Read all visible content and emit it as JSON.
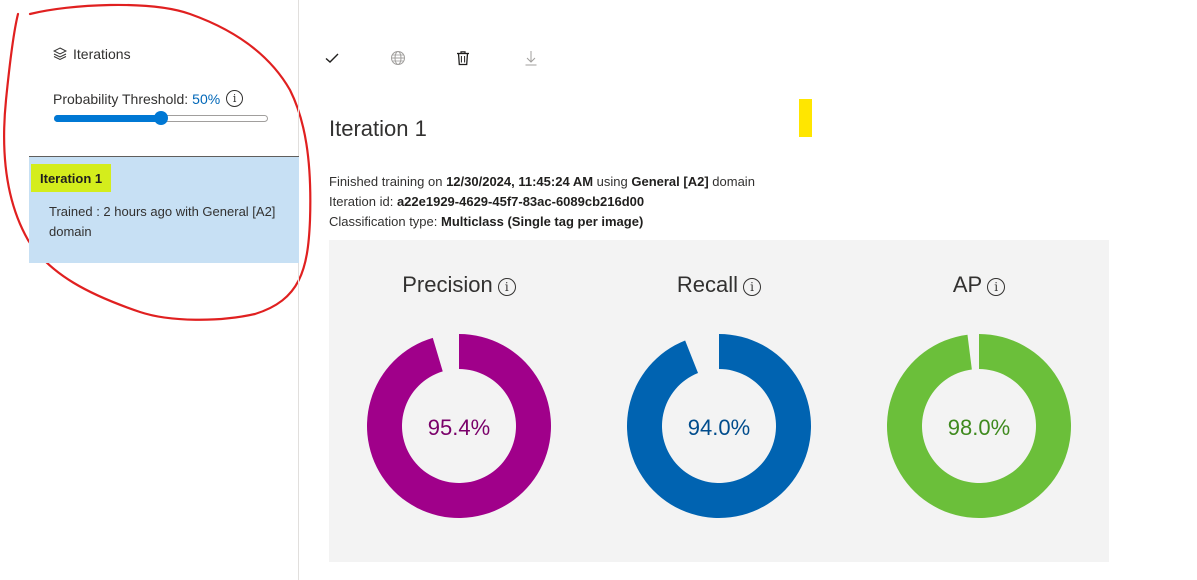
{
  "sidebar": {
    "header_label": "Iterations",
    "threshold_label": "Probability Threshold:",
    "threshold_value": "50%",
    "threshold_fraction": 0.5,
    "iterations": [
      {
        "name": "Iteration 1",
        "description": "Trained : 2 hours ago with General [A2] domain"
      }
    ]
  },
  "toolbar": {
    "icons": [
      "check-icon",
      "globe-icon",
      "trash-icon",
      "download-icon"
    ]
  },
  "main": {
    "title": "Iteration 1",
    "finished_prefix": "Finished training on ",
    "finished_date": "12/30/2024, 11:45:24 AM",
    "finished_mid": " using ",
    "finished_domain": "General [A2]",
    "finished_suffix": " domain",
    "iteration_id_label": "Iteration id: ",
    "iteration_id": "a22e1929-4629-45f7-83ac-6089cb216d00",
    "classification_label": "Classification type: ",
    "classification_value": "Multiclass (Single tag per image)"
  },
  "metrics": [
    {
      "name": "Precision",
      "value": 95.4,
      "display": "95.4%",
      "color": "#a0008a",
      "text_color": "#7a006a"
    },
    {
      "name": "Recall",
      "value": 94.0,
      "display": "94.0%",
      "color": "#0063b1",
      "text_color": "#004c8c"
    },
    {
      "name": "AP",
      "value": 98.0,
      "display": "98.0%",
      "color": "#6bbf3a",
      "text_color": "#3f8a1e"
    }
  ],
  "annotations": {
    "red_circle_color": "#e02020",
    "yellow_mark_color": "#ffe600",
    "highlight_color": "#d4ed1c"
  }
}
